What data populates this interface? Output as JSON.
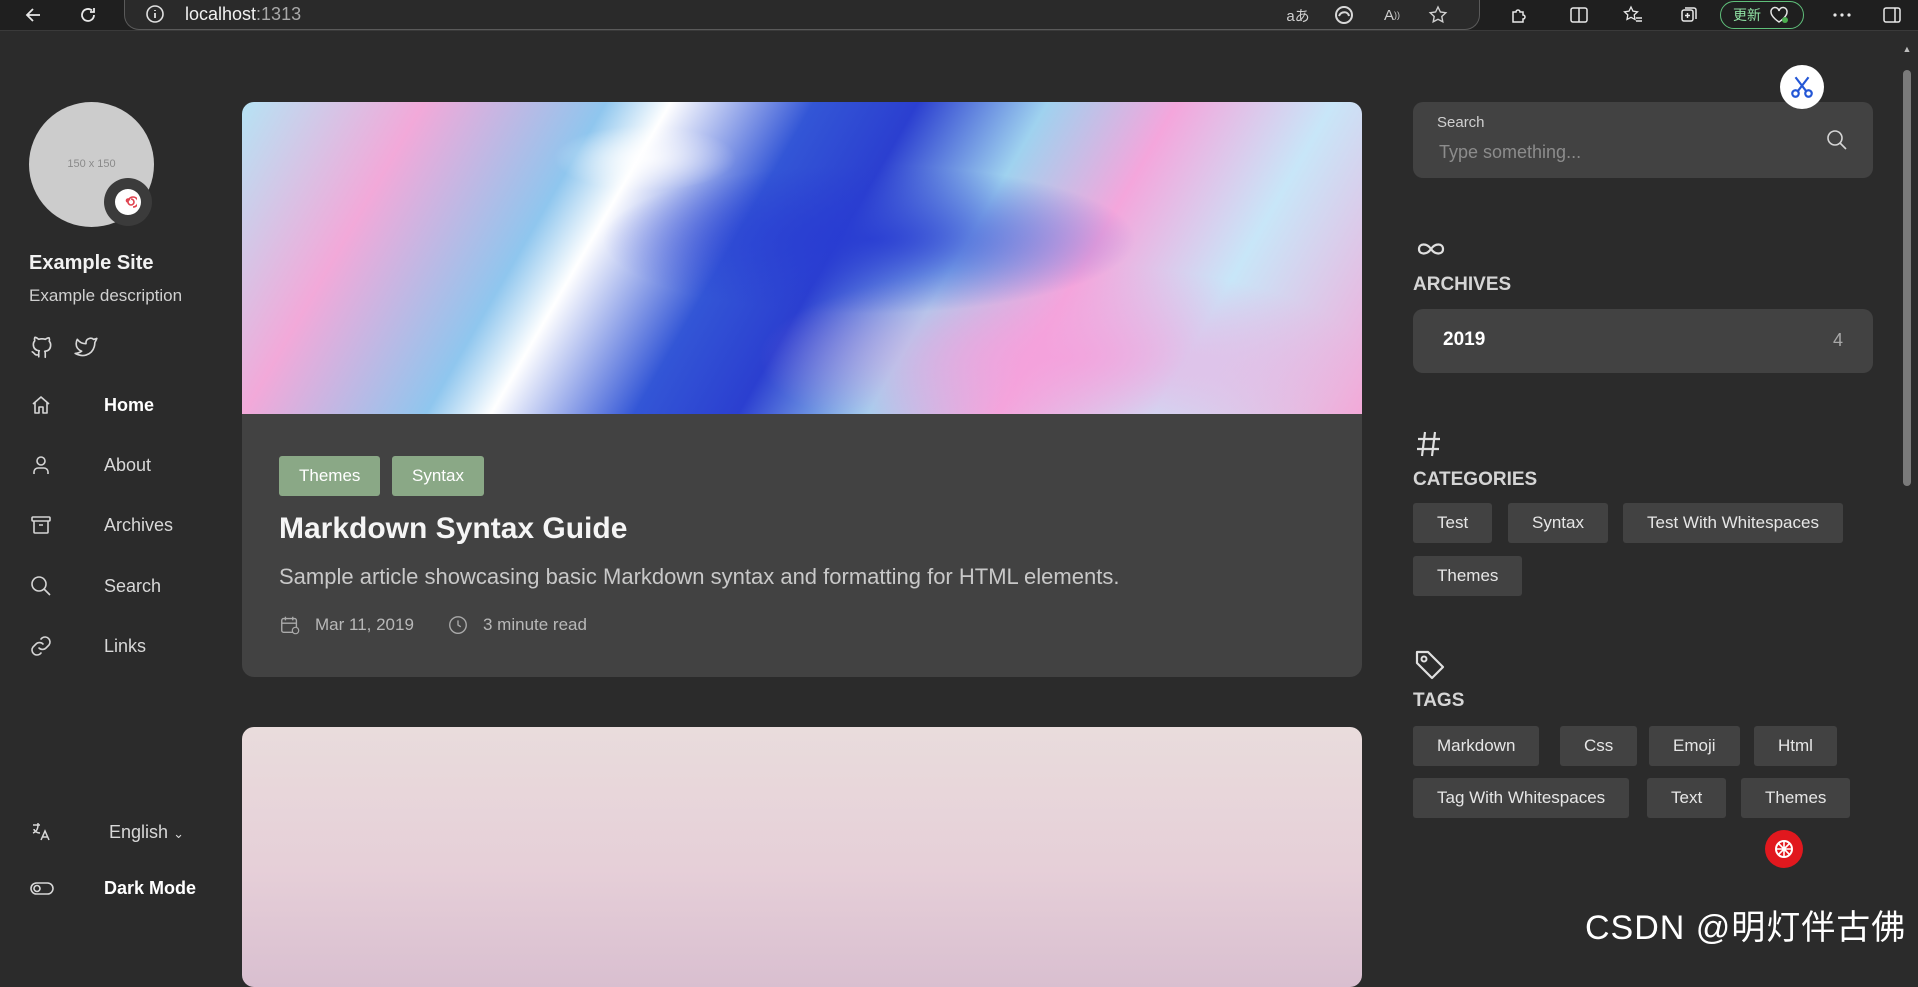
{
  "browser": {
    "url_host": "localhost",
    "url_port": ":1313",
    "update_label": "更新"
  },
  "site": {
    "avatar_placeholder": "150 x 150",
    "title": "Example Site",
    "description": "Example description"
  },
  "menu": {
    "items": [
      {
        "label": "Home",
        "icon": "home-icon",
        "active": true
      },
      {
        "label": "About",
        "icon": "user-icon"
      },
      {
        "label": "Archives",
        "icon": "archive-icon"
      },
      {
        "label": "Search",
        "icon": "search-icon"
      },
      {
        "label": "Links",
        "icon": "link-icon"
      }
    ],
    "language": "English",
    "dark_mode": "Dark Mode"
  },
  "article": {
    "categories": [
      "Themes",
      "Syntax"
    ],
    "title": "Markdown Syntax Guide",
    "excerpt": "Sample article showcasing basic Markdown syntax and formatting for HTML elements.",
    "date": "Mar 11, 2019",
    "reading_time": "3 minute read"
  },
  "sidebar": {
    "search": {
      "label": "Search",
      "placeholder": "Type something..."
    },
    "archives": {
      "title": "ARCHIVES",
      "rows": [
        {
          "year": "2019",
          "count": "4"
        }
      ]
    },
    "categories": {
      "title": "CATEGORIES",
      "items": [
        "Test",
        "Syntax",
        "Test With Whitespaces",
        "Themes"
      ]
    },
    "tags": {
      "title": "TAGS",
      "items": [
        "Markdown",
        "Css",
        "Emoji",
        "Html",
        "Tag With Whitespaces",
        "Text",
        "Themes"
      ]
    }
  },
  "watermark": "CSDN @明灯伴古佛",
  "colors": {
    "background": "#2b2b2b",
    "card": "#424242",
    "accent": "#8aa886"
  }
}
